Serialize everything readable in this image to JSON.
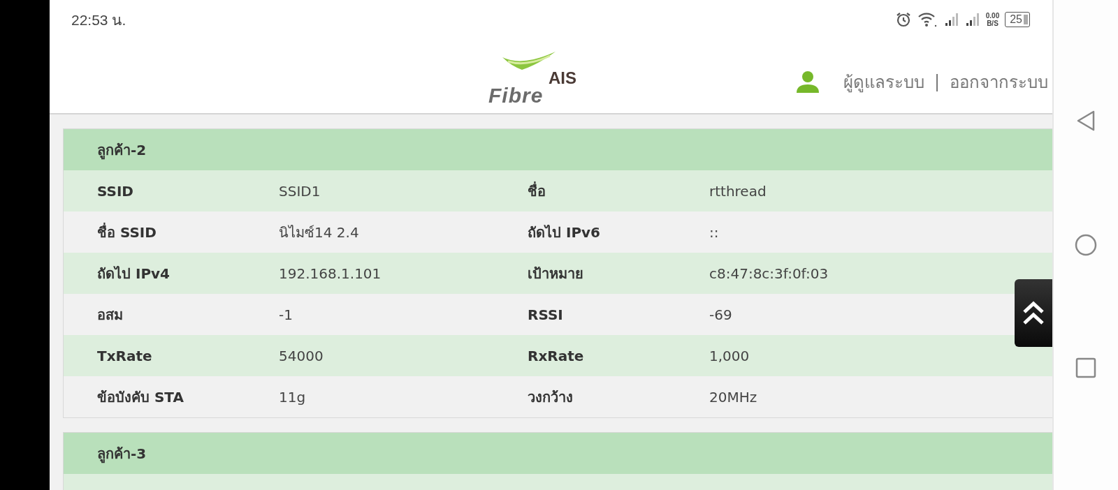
{
  "status_bar": {
    "time": "22:53 น.",
    "speed_value": "0.00",
    "speed_unit": "B/S",
    "battery": "25"
  },
  "header": {
    "logo_top": "AIS",
    "logo_bottom": "Fibre",
    "user": "ผู้ดูแลระบบ",
    "separator": "|",
    "logout": "ออกจากระบบ"
  },
  "clients": [
    {
      "title": "ลูกค้า-2",
      "rows": [
        {
          "label_1": "SSID",
          "value_1": "SSID1",
          "label_2": "ชื่อ",
          "value_2": "rtthread"
        },
        {
          "label_1": "ชื่อ SSID",
          "value_1": "นิไมซ์14 2.4",
          "label_2": "ถัดไป IPv6",
          "value_2": "::"
        },
        {
          "label_1": "ถัดไป IPv4",
          "value_1": "192.168.1.101",
          "label_2": "เป้าหมาย",
          "value_2": "c8:47:8c:3f:0f:03"
        },
        {
          "label_1": "อสม",
          "value_1": "-1",
          "label_2": "RSSI",
          "value_2": "-69"
        },
        {
          "label_1": "TxRate",
          "value_1": "54000",
          "label_2": "RxRate",
          "value_2": "1,000"
        },
        {
          "label_1": "ข้อบังคับ STA",
          "value_1": "11g",
          "label_2": "วงกว้าง",
          "value_2": "20MHz"
        }
      ]
    },
    {
      "title": "ลูกค้า-3"
    }
  ]
}
